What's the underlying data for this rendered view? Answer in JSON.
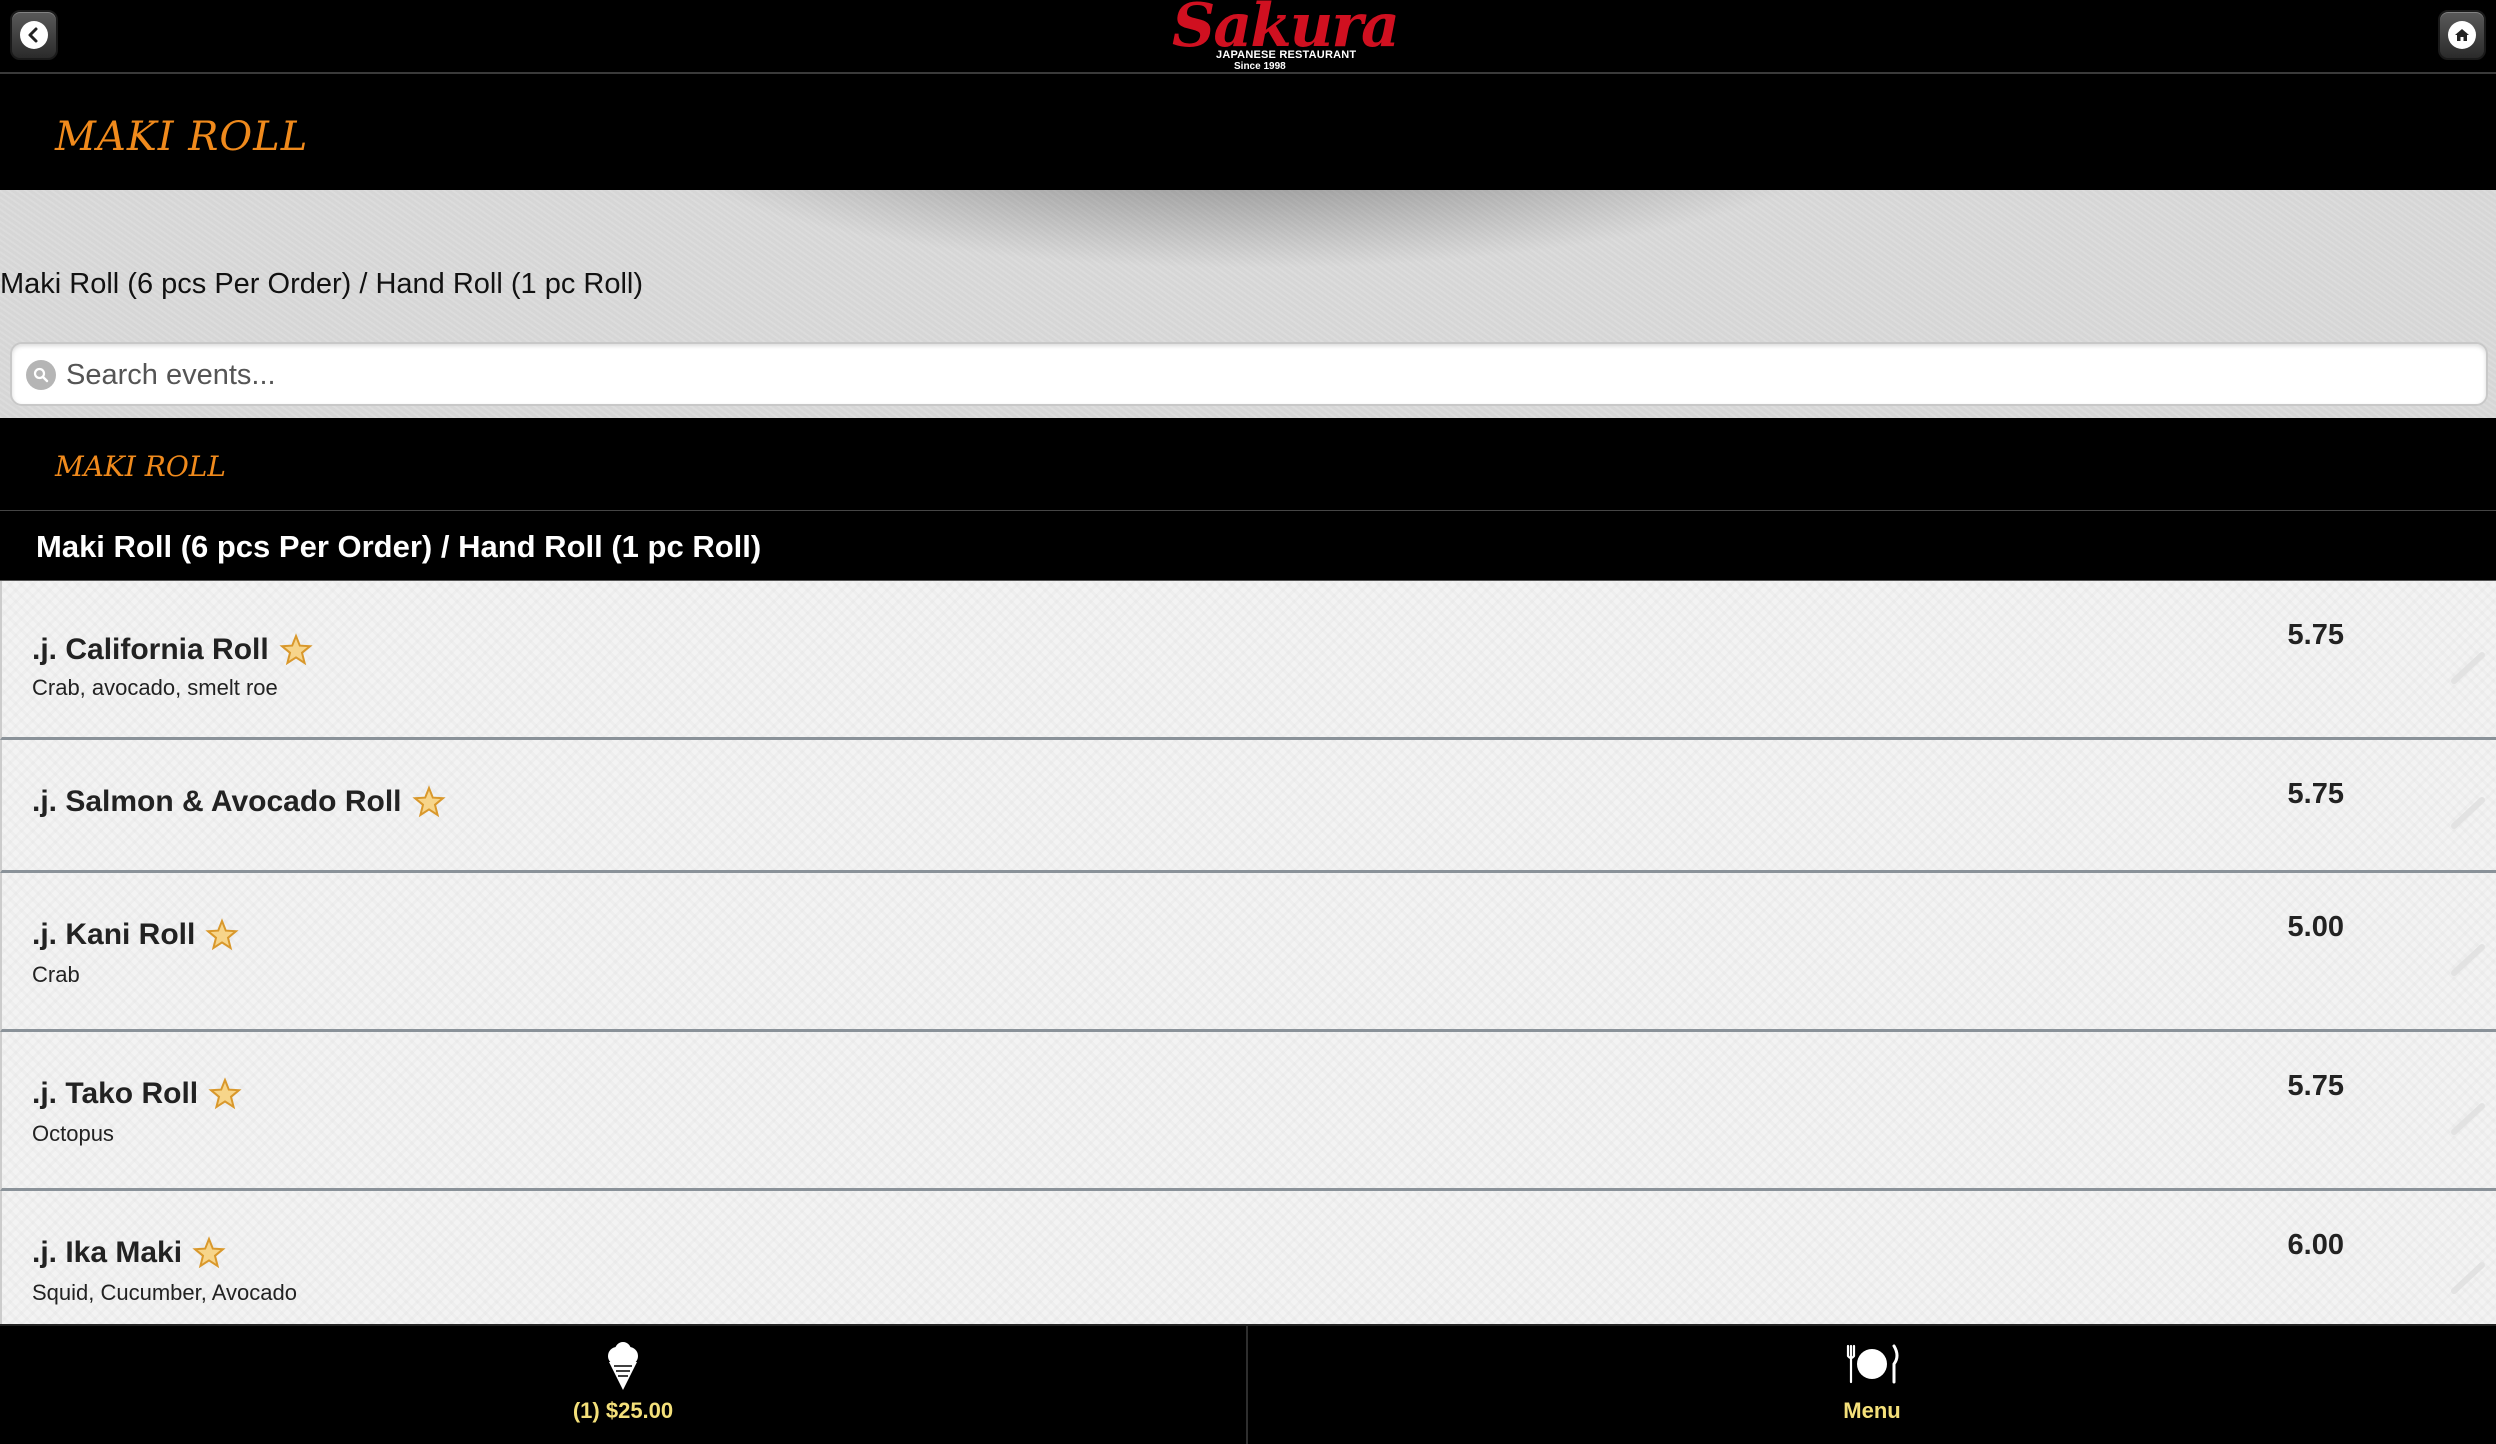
{
  "topbar": {
    "back_icon": "chevron-left-icon",
    "home_icon": "home-icon",
    "logo_text": "Sakura",
    "logo_subtitle": "JAPANESE RESTAURANT",
    "logo_since": "Since 1998"
  },
  "header": {
    "title": "MAKI ROLL"
  },
  "subtitle": "Maki Roll (6 pcs Per Order) / Hand Roll (1 pc Roll)",
  "search": {
    "placeholder": "Search events...",
    "value": ""
  },
  "section": {
    "title": "MAKI ROLL"
  },
  "category": {
    "title": "Maki Roll (6 pcs Per Order) / Hand Roll (1 pc Roll)"
  },
  "items": [
    {
      "name": ".j. California Roll",
      "desc": "Crab, avocado, smelt roe",
      "price": "5.75"
    },
    {
      "name": ".j. Salmon & Avocado Roll",
      "desc": "",
      "price": "5.75"
    },
    {
      "name": ".j. Kani Roll",
      "desc": "Crab",
      "price": "5.00"
    },
    {
      "name": ".j. Tako Roll",
      "desc": "Octopus",
      "price": "5.75"
    },
    {
      "name": ".j. Ika Maki",
      "desc": "Squid, Cucumber, Avocado",
      "price": "6.00"
    }
  ],
  "bottombar": {
    "cart_label": "(1) $25.00",
    "cart_icon": "ice-cream-icon",
    "menu_label": "Menu",
    "menu_icon": "plate-fork-knife-icon"
  },
  "colors": {
    "accent": "#f08a1c",
    "tab_label": "#f4e07a",
    "logo": "#d01020"
  }
}
